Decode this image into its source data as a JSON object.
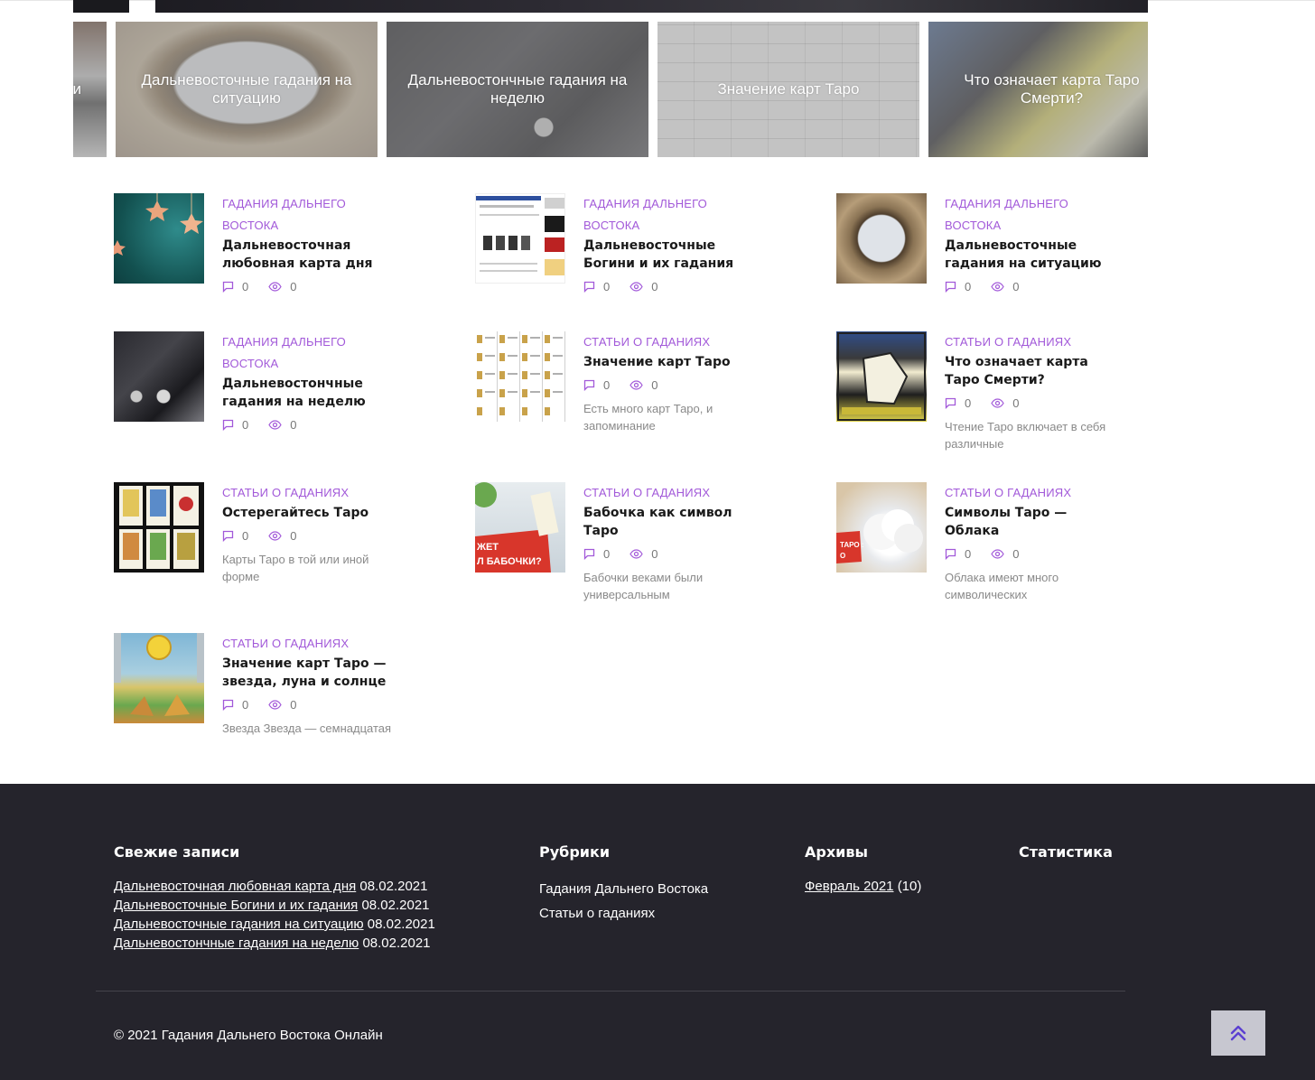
{
  "slider": {
    "slides": [
      {
        "caption": "и"
      },
      {
        "caption": "Дальневосточные гадания на ситуацию"
      },
      {
        "caption": "Дальневостончные гадания на неделю"
      },
      {
        "caption": "Значение карт Таро"
      },
      {
        "caption": "Что означает карта Таро Смерти?"
      }
    ]
  },
  "posts": [
    {
      "category": "ГАДАНИЯ ДАЛЬНЕГО ВОСТОКА",
      "title": "Дальневосточная любовная карта дня",
      "comments": "0",
      "views": "0",
      "excerpt": ""
    },
    {
      "category": "ГАДАНИЯ ДАЛЬНЕГО ВОСТОКА",
      "title": "Дальневосточные Богини и их гадания",
      "comments": "0",
      "views": "0",
      "excerpt": ""
    },
    {
      "category": "ГАДАНИЯ ДАЛЬНЕГО ВОСТОКА",
      "title": "Дальневосточные гадания на ситуацию",
      "comments": "0",
      "views": "0",
      "excerpt": ""
    },
    {
      "category": "ГАДАНИЯ ДАЛЬНЕГО ВОСТОКА",
      "title": "Дальневостончные гадания на неделю",
      "comments": "0",
      "views": "0",
      "excerpt": ""
    },
    {
      "category": "СТАТЬИ О ГАДАНИЯХ",
      "title": "Значение карт Таро",
      "comments": "0",
      "views": "0",
      "excerpt": "Есть много карт Таро, и запоминание"
    },
    {
      "category": "СТАТЬИ О ГАДАНИЯХ",
      "title": "Что означает карта Таро Смерти?",
      "comments": "0",
      "views": "0",
      "excerpt": "Чтение Таро включает в себя различные"
    },
    {
      "category": "СТАТЬИ О ГАДАНИЯХ",
      "title": "Остерегайтесь Таро",
      "comments": "0",
      "views": "0",
      "excerpt": "Карты Таро в той или иной форме"
    },
    {
      "category": "СТАТЬИ О ГАДАНИЯХ",
      "title": "Бабочка как символ Таро",
      "comments": "0",
      "views": "0",
      "excerpt": "Бабочки веками были универсальным"
    },
    {
      "category": "СТАТЬИ О ГАДАНИЯХ",
      "title": "Символы Таро — Облака",
      "comments": "0",
      "views": "0",
      "excerpt": "Облака имеют много символических"
    },
    {
      "category": "СТАТЬИ О ГАДАНИЯХ",
      "title": "Значение карт Таро — звезда, луна и солнце",
      "comments": "0",
      "views": "0",
      "excerpt": "Звезда Звезда — семнадцатая"
    }
  ],
  "thumb_texts": {
    "butterfly": "ЖЕТ\nЛ БАБОЧКИ?",
    "clouds": "ТАРО :\nО"
  },
  "footer": {
    "recent": {
      "heading": "Свежие записи",
      "items": [
        {
          "link": "Дальневосточная любовная карта дня",
          "date": "08.02.2021"
        },
        {
          "link": "Дальневосточные Богини и их гадания",
          "date": "08.02.2021"
        },
        {
          "link": "Дальневосточные гадания на ситуацию",
          "date": "08.02.2021"
        },
        {
          "link": "Дальневостончные гадания на неделю",
          "date": "08.02.2021"
        }
      ]
    },
    "rubrics": {
      "heading": "Рубрики",
      "items": [
        "Гадания Дальнего Востока",
        "Статьи о гаданиях"
      ]
    },
    "archives": {
      "heading": "Архивы",
      "items": [
        {
          "link": "Февраль 2021",
          "count": "(10)"
        }
      ]
    },
    "stats": {
      "heading": "Статистика"
    },
    "copyright": "© 2021 Гадания Дальнего Востока Онлайн"
  },
  "colors": {
    "accent": "#a259d9",
    "footer_bg": "#25242c",
    "to_top_bg": "#c7c7d0",
    "to_top_icon": "#5b3fd1"
  },
  "icons": {
    "comment": "comment-icon",
    "views": "eye-icon",
    "to_top": "double-chevron-up-icon"
  }
}
